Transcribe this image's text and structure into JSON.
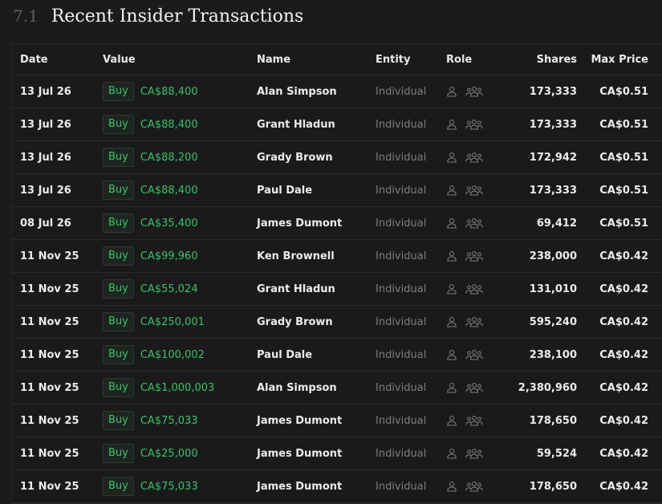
{
  "section": {
    "number": "7.1",
    "title": "Recent Insider Transactions"
  },
  "columns": {
    "date": "Date",
    "value": "Value",
    "name": "Name",
    "entity": "Entity",
    "role": "Role",
    "shares": "Shares",
    "max_price": "Max Price"
  },
  "icons": {
    "individual": "person-icon",
    "group": "people-group-icon"
  },
  "colors": {
    "buy_green": "#36c26a",
    "background": "#1b1b1b"
  },
  "rows": [
    {
      "date": "13 Jul 26",
      "type": "Buy",
      "value": "CA$88,400",
      "name": "Alan Simpson",
      "entity": "Individual",
      "shares": "173,333",
      "max_price": "CA$0.51"
    },
    {
      "date": "13 Jul 26",
      "type": "Buy",
      "value": "CA$88,400",
      "name": "Grant Hladun",
      "entity": "Individual",
      "shares": "173,333",
      "max_price": "CA$0.51"
    },
    {
      "date": "13 Jul 26",
      "type": "Buy",
      "value": "CA$88,200",
      "name": "Grady Brown",
      "entity": "Individual",
      "shares": "172,942",
      "max_price": "CA$0.51"
    },
    {
      "date": "13 Jul 26",
      "type": "Buy",
      "value": "CA$88,400",
      "name": "Paul Dale",
      "entity": "Individual",
      "shares": "173,333",
      "max_price": "CA$0.51"
    },
    {
      "date": "08 Jul 26",
      "type": "Buy",
      "value": "CA$35,400",
      "name": "James Dumont",
      "entity": "Individual",
      "shares": "69,412",
      "max_price": "CA$0.51"
    },
    {
      "date": "11 Nov 25",
      "type": "Buy",
      "value": "CA$99,960",
      "name": "Ken Brownell",
      "entity": "Individual",
      "shares": "238,000",
      "max_price": "CA$0.42"
    },
    {
      "date": "11 Nov 25",
      "type": "Buy",
      "value": "CA$55,024",
      "name": "Grant Hladun",
      "entity": "Individual",
      "shares": "131,010",
      "max_price": "CA$0.42"
    },
    {
      "date": "11 Nov 25",
      "type": "Buy",
      "value": "CA$250,001",
      "name": "Grady Brown",
      "entity": "Individual",
      "shares": "595,240",
      "max_price": "CA$0.42"
    },
    {
      "date": "11 Nov 25",
      "type": "Buy",
      "value": "CA$100,002",
      "name": "Paul Dale",
      "entity": "Individual",
      "shares": "238,100",
      "max_price": "CA$0.42"
    },
    {
      "date": "11 Nov 25",
      "type": "Buy",
      "value": "CA$1,000,003",
      "name": "Alan Simpson",
      "entity": "Individual",
      "shares": "2,380,960",
      "max_price": "CA$0.42"
    },
    {
      "date": "11 Nov 25",
      "type": "Buy",
      "value": "CA$75,033",
      "name": "James Dumont",
      "entity": "Individual",
      "shares": "178,650",
      "max_price": "CA$0.42"
    },
    {
      "date": "11 Nov 25",
      "type": "Buy",
      "value": "CA$25,000",
      "name": "James Dumont",
      "entity": "Individual",
      "shares": "59,524",
      "max_price": "CA$0.42"
    },
    {
      "date": "11 Nov 25",
      "type": "Buy",
      "value": "CA$75,033",
      "name": "James Dumont",
      "entity": "Individual",
      "shares": "178,650",
      "max_price": "CA$0.42"
    }
  ]
}
